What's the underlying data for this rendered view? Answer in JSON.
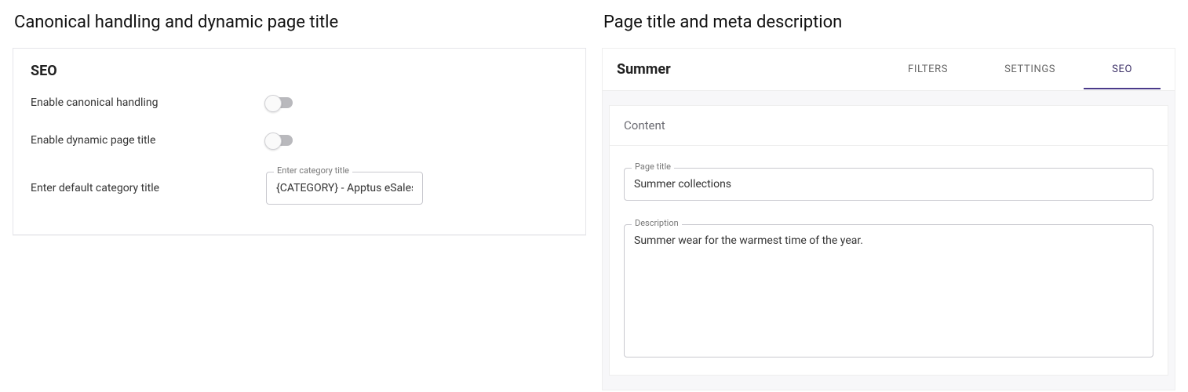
{
  "left": {
    "pane_title": "Canonical handling and dynamic page title",
    "section_title": "SEO",
    "rows": {
      "canonical_label": "Enable canonical handling",
      "dynamic_label": "Enable dynamic page title",
      "default_cat_label": "Enter default category title",
      "cat_field_legend": "Enter category title",
      "cat_field_value": "{CATEGORY} - Apptus eSales"
    }
  },
  "right": {
    "pane_title": "Page title and meta description",
    "header_title": "Summer",
    "tabs": {
      "filters": "FILTERS",
      "settings": "SETTINGS",
      "seo": "SEO"
    },
    "content": {
      "section_label": "Content",
      "page_title_legend": "Page title",
      "page_title_value": "Summer collections",
      "description_legend": "Description",
      "description_value": "Summer wear for the warmest time of the year."
    }
  }
}
